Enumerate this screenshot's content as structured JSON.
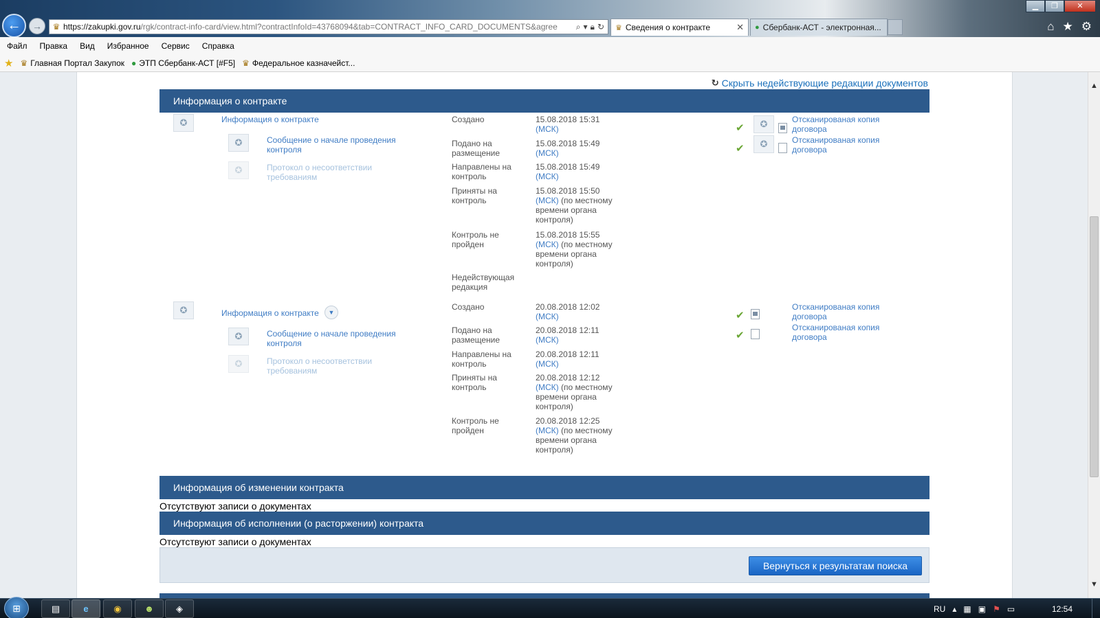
{
  "browser": {
    "url_host": "https://zakupki.gov.ru",
    "url_path": "/rgk/contract-info-card/view.html?contractInfoId=43768094&tab=CONTRACT_INFO_CARD_DOCUMENTS&agree",
    "tabs": [
      {
        "label": "Сведения о контракте",
        "active": true
      },
      {
        "label": "Сбербанк-АСТ - электронная..."
      }
    ],
    "menu": [
      "Файл",
      "Правка",
      "Вид",
      "Избранное",
      "Сервис",
      "Справка"
    ],
    "favorites": [
      "Главная Портал Закупок",
      "ЭТП Сбербанк-АСТ [#F5]",
      "Федеральное казначейст..."
    ]
  },
  "page": {
    "hide_link": "Скрыть недействующие редакции документов",
    "sections": {
      "contract_info": "Информация о контракте",
      "changes": "Информация об изменении контракта",
      "execution": "Информация об исполнении (о расторжении) контракта"
    },
    "empty_note": "Отсутствуют записи о документах",
    "back_button": "Вернуться к результатам поиска",
    "block1": {
      "main_doc": "Информация о контракте",
      "sub_doc1_l1": "Сообщение о начале проведения",
      "sub_doc1_l2": "контроля",
      "sub_doc2_l1": "Протокол о несоответствии",
      "sub_doc2_l2": "требованиям",
      "statuses": [
        {
          "l1": "Создано",
          "l2": "",
          "date": "15.08.2018 15:31",
          "tz": "(МСК)",
          "note1": "",
          "note2": "",
          "note3": ""
        },
        {
          "l1": "Подано на",
          "l2": "размещение",
          "date": "15.08.2018 15:49",
          "tz": "(МСК)",
          "note1": "",
          "note2": "",
          "note3": ""
        },
        {
          "l1": "Направлены на",
          "l2": "контроль",
          "date": "15.08.2018 15:49",
          "tz": "(МСК)",
          "note1": "",
          "note2": "",
          "note3": ""
        },
        {
          "l1": "Приняты на",
          "l2": "контроль",
          "date": "15.08.2018 15:50",
          "tz": "(МСК)",
          "note1": " (по местному",
          "note2": "времени органа",
          "note3": "контроля)"
        },
        {
          "l1": "Контроль не",
          "l2": "пройден",
          "date": "15.08.2018 15:55",
          "tz": "(МСК)",
          "note1": " (по местному",
          "note2": "времени органа",
          "note3": "контроля)"
        },
        {
          "l1": "Недействующая",
          "l2": "редакция"
        }
      ],
      "scans": [
        {
          "l1": "Отсканированая копия",
          "l2": "договора"
        },
        {
          "l1": "Отсканированая копия",
          "l2": "договора"
        }
      ]
    },
    "block2": {
      "main_doc": "Информация о контракте",
      "sub_doc1_l1": "Сообщение о начале проведения",
      "sub_doc1_l2": "контроля",
      "sub_doc2_l1": "Протокол о несоответствии",
      "sub_doc2_l2": "требованиям",
      "statuses": [
        {
          "l1": "Создано",
          "l2": "",
          "date": "20.08.2018 12:02",
          "tz": "(МСК)",
          "note1": "",
          "note2": "",
          "note3": ""
        },
        {
          "l1": "Подано на",
          "l2": "размещение",
          "date": "20.08.2018 12:11",
          "tz": "(МСК)",
          "note1": "",
          "note2": "",
          "note3": ""
        },
        {
          "l1": "Направлены на",
          "l2": "контроль",
          "date": "20.08.2018 12:11",
          "tz": "(МСК)",
          "note1": "",
          "note2": "",
          "note3": ""
        },
        {
          "l1": "Приняты на",
          "l2": "контроль",
          "date": "20.08.2018 12:12",
          "tz": "(МСК)",
          "note1": " (по местному",
          "note2": "времени органа",
          "note3": "контроля)"
        },
        {
          "l1": "Контроль не",
          "l2": "пройден",
          "date": "20.08.2018 12:25",
          "tz": "(МСК)",
          "note1": " (по местному",
          "note2": "времени органа",
          "note3": "контроля)"
        }
      ],
      "scans": [
        {
          "l1": "Отсканированая копия",
          "l2": "договора"
        },
        {
          "l1": "Отсканированая копия",
          "l2": "договора"
        }
      ]
    }
  },
  "taskbar": {
    "lang": "RU",
    "clock": "12:54"
  }
}
